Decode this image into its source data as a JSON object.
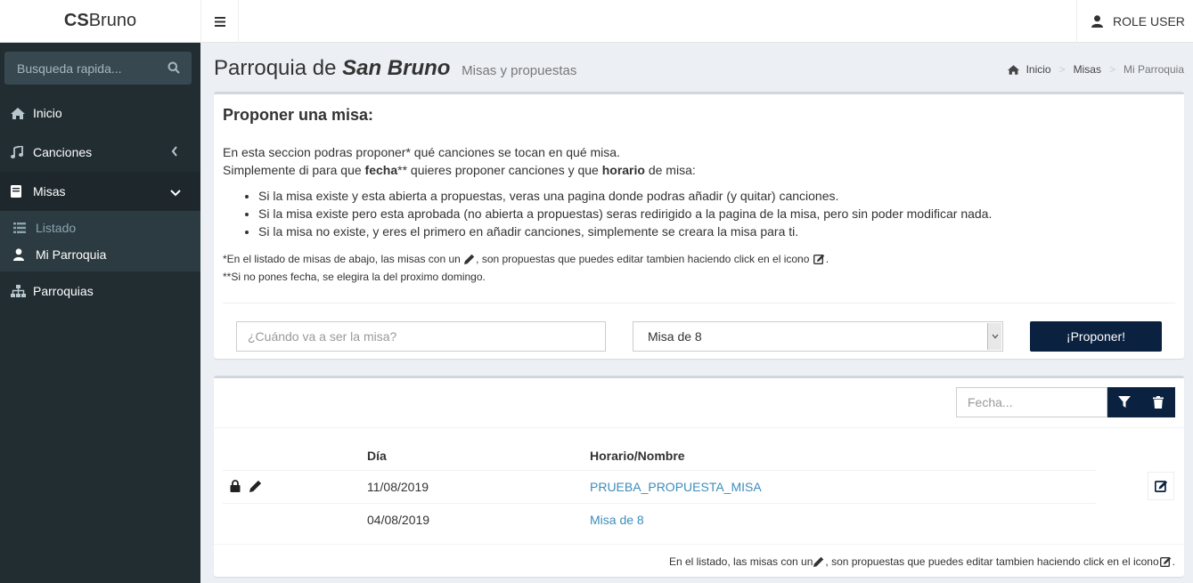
{
  "app": {
    "logo_bold": "CS",
    "logo_rest": "Bruno"
  },
  "header": {
    "user_label": "ROLE USER"
  },
  "sidebar": {
    "search_placeholder": "Busqueda rapida...",
    "items": [
      {
        "label": "Inicio",
        "icon": "home-icon"
      },
      {
        "label": "Canciones",
        "icon": "music-icon"
      },
      {
        "label": "Misas",
        "icon": "book-icon"
      },
      {
        "label": "Parroquias",
        "icon": "sitemap-icon"
      }
    ],
    "submenu": [
      {
        "label": "Listado",
        "icon": "list-icon"
      },
      {
        "label": "Mi Parroquia",
        "icon": "user-icon"
      }
    ]
  },
  "page": {
    "title_prefix": "Parroquia de",
    "title_name": "San Bruno",
    "subtitle": "Misas y propuestas",
    "breadcrumb": [
      "Inicio",
      "Misas",
      "Mi Parroquia"
    ]
  },
  "propose": {
    "title": "Proponer una misa:",
    "intro_line1": "En esta seccion podras proponer* qué canciones se tocan en qué misa.",
    "intro_line2_a": "Simplemente di para que",
    "intro_line2_b": "fecha",
    "intro_line2_c": "** quieres proponer canciones y que",
    "intro_line2_d": "horario",
    "intro_line2_e": "de misa:",
    "bullets": [
      "Si la misa existe y esta abierta a propuestas, veras una pagina donde podras añadir (y quitar) canciones.",
      "Si la misa existe pero esta aprobada (no abierta a propuestas) seras redirigido a la pagina de la misa, pero sin poder modificar nada.",
      "Si la misa no existe, y eres el primero en añadir canciones, simplemente se creara la misa para ti."
    ],
    "note1_a": "*En el listado de misas de abajo, las misas con un",
    "note1_b": ", son propuestas que puedes editar tambien haciendo click en el icono",
    "note1_c": ".",
    "note2": "**Si no pones fecha, se elegira la del proximo domingo.",
    "date_placeholder": "¿Cuándo va a ser la misa?",
    "select_value": "Misa de 8",
    "submit_label": "¡Proponer!"
  },
  "listing": {
    "filter_placeholder": "Fecha...",
    "headers": {
      "day": "Día",
      "name": "Horario/Nombre"
    },
    "rows": [
      {
        "date": "11/08/2019",
        "name": "PRUEBA_PROPUESTA_MISA",
        "locked": true,
        "editable": true
      },
      {
        "date": "04/08/2019",
        "name": "Misa de 8",
        "locked": false,
        "editable": false
      }
    ],
    "footer_a": "En el listado, las misas con un",
    "footer_b": ", son propuestas que puedes editar tambien haciendo click en el icono",
    "footer_c": "."
  },
  "colors": {
    "sidebar": "#222d32",
    "primary_button": "#0a2140",
    "link": "#3c8dbc"
  }
}
